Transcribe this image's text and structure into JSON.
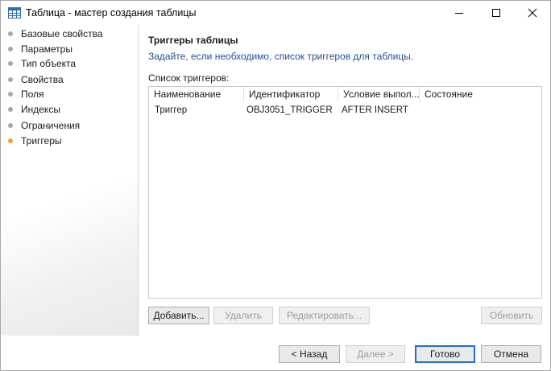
{
  "window": {
    "title": "Таблица - мастер создания таблицы"
  },
  "sidebar": {
    "steps": [
      {
        "label": "Базовые свойства",
        "state": "pending"
      },
      {
        "label": "Параметры",
        "state": "pending"
      },
      {
        "label": "Тип объекта",
        "state": "pending"
      },
      {
        "label": "Свойства",
        "state": "pending"
      },
      {
        "label": "Поля",
        "state": "pending"
      },
      {
        "label": "Индексы",
        "state": "pending"
      },
      {
        "label": "Ограничения",
        "state": "pending"
      },
      {
        "label": "Триггеры",
        "state": "active"
      }
    ]
  },
  "page": {
    "title": "Триггеры таблицы",
    "description": "Задайте, если необходимо, список триггеров для таблицы.",
    "list_label": "Список триггеров:"
  },
  "grid": {
    "columns": [
      "Наименование",
      "Идентификатор",
      "Условие выпол...",
      "Состояние"
    ],
    "rows": [
      [
        "Триггер",
        "OBJ3051_TRIGGER",
        "AFTER INSERT",
        ""
      ]
    ]
  },
  "actions": {
    "add": "Добавить...",
    "delete": "Удалить",
    "edit": "Редактировать...",
    "refresh": "Обновить"
  },
  "footer": {
    "back": "< Назад",
    "next": "Далее >",
    "finish": "Готово",
    "cancel": "Отмена"
  },
  "colors": {
    "active_step": "#f0a030",
    "inactive_step": "#a8a8a8",
    "description_text": "#1e4f8f",
    "primary_border": "#1f6fd1"
  }
}
